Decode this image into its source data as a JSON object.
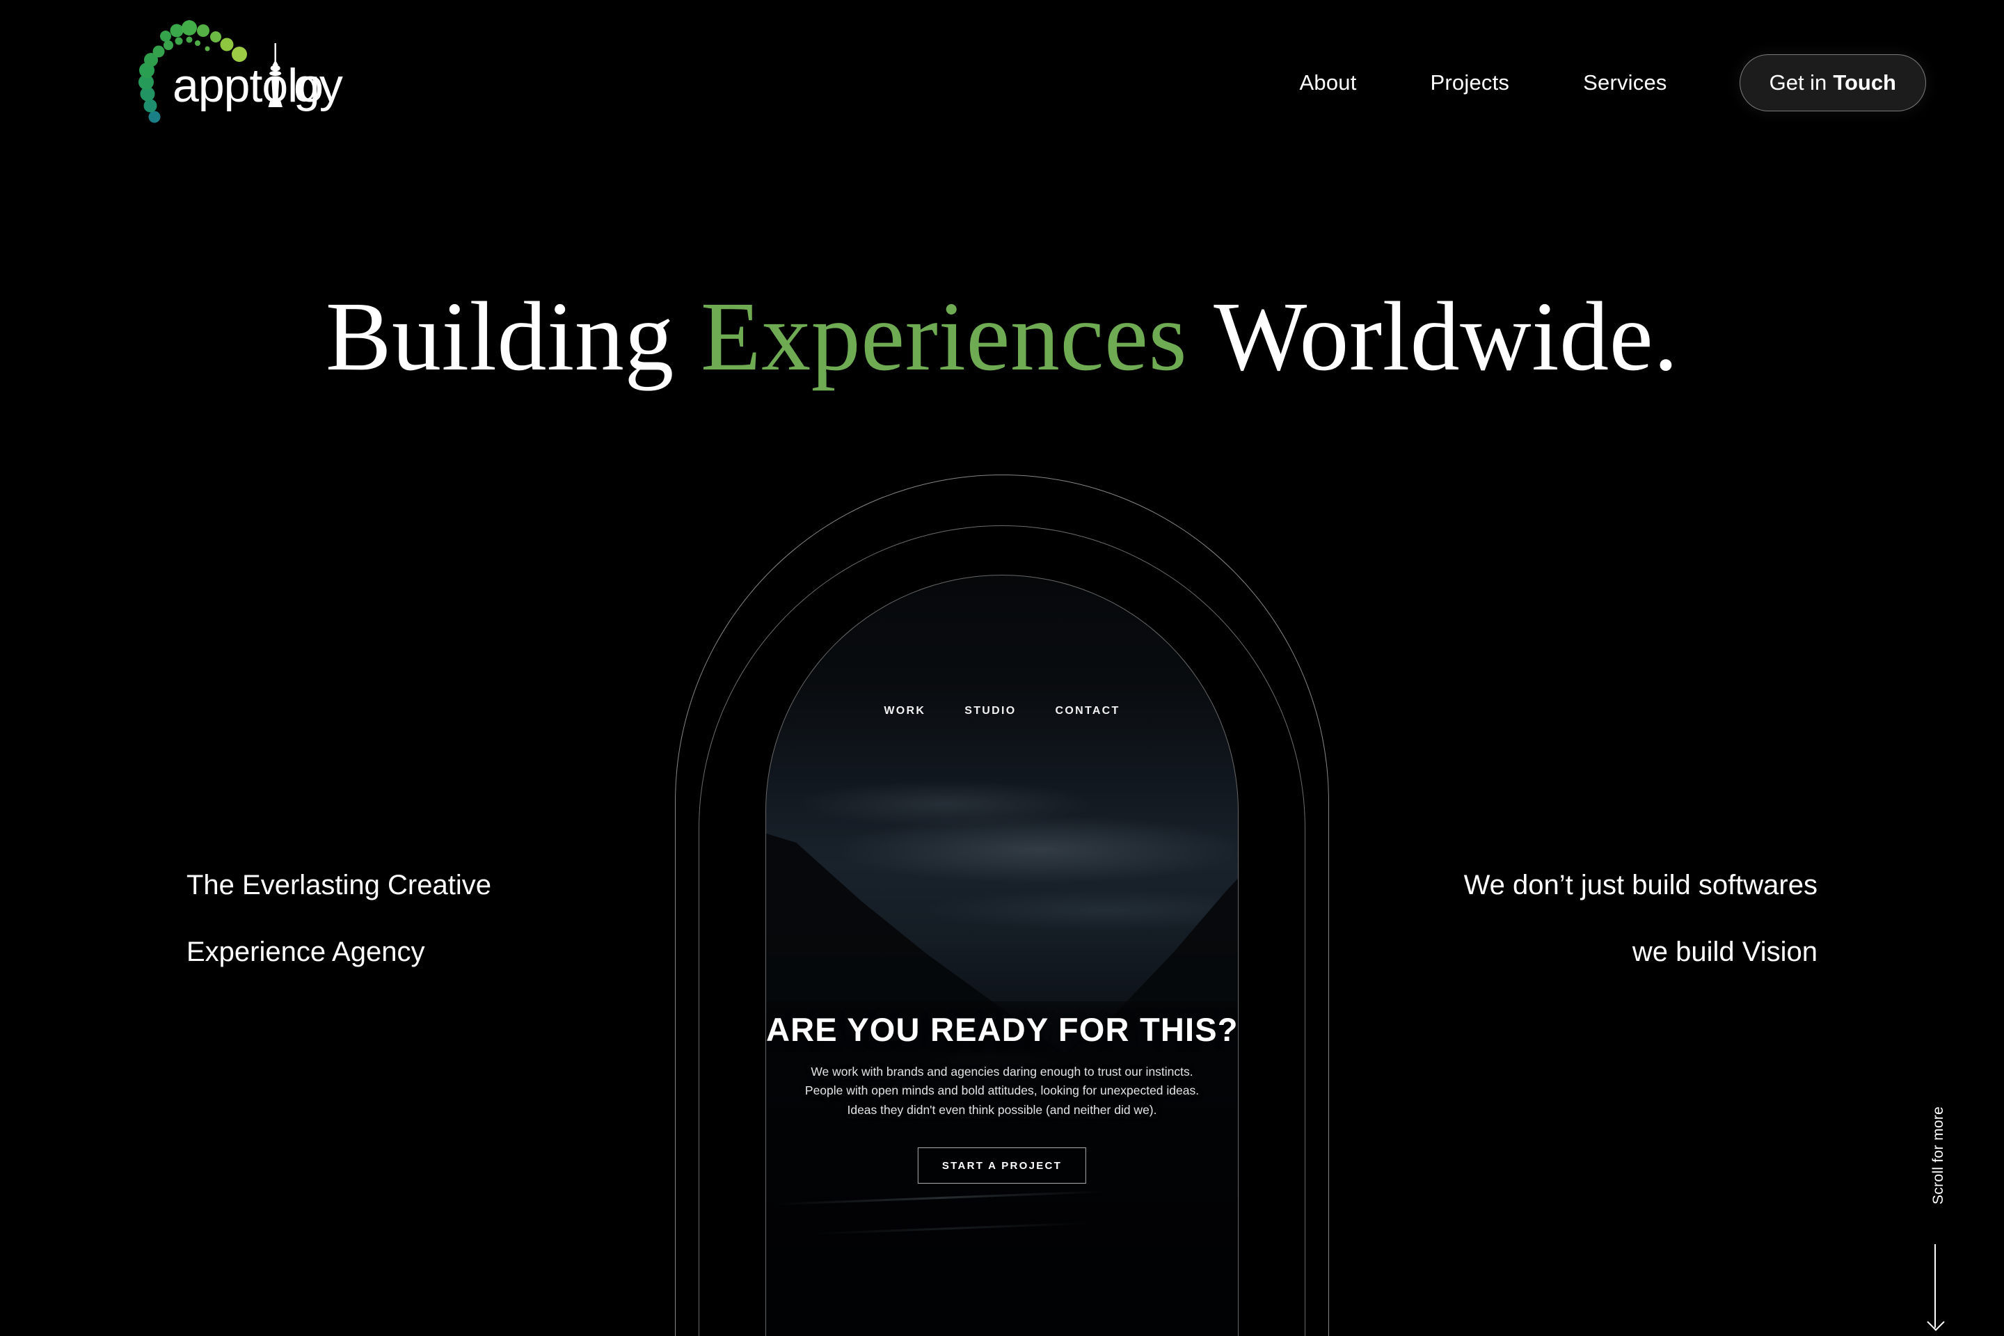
{
  "brand": {
    "name": "apptology",
    "logo_icon": "apptology-dot-arc-tower-logo",
    "dot_arc_colors": [
      "#2e9b60",
      "#2f9f4e",
      "#3fa94a",
      "#55b046",
      "#7cc04a",
      "#9ccb45",
      "#8ec63f",
      "#1e8e6e",
      "#1a7f86"
    ],
    "wordmark_color": "#ffffff"
  },
  "header": {
    "nav": [
      {
        "label": "About"
      },
      {
        "label": "Projects"
      },
      {
        "label": "Services"
      }
    ],
    "cta": {
      "label_regular": "Get in",
      "label_bold": "Touch",
      "background": "#1c1c1c",
      "border_color": "rgba(255,255,255,0.42)"
    }
  },
  "hero": {
    "headline_part1": "Building",
    "headline_accent": "Experiences",
    "headline_part2": "Worldwide.",
    "accent_color": "#6fab52",
    "text_color": "#ffffff"
  },
  "side_copy": {
    "left": {
      "line1": "The Everlasting Creative",
      "line2": "Experience Agency"
    },
    "right": {
      "line1": "We don’t just build softwares",
      "line2": "we build Vision"
    }
  },
  "arch_preview": {
    "mini_nav": [
      {
        "label": "WORK"
      },
      {
        "label": "STUDIO"
      },
      {
        "label": "CONTACT"
      }
    ],
    "headline": "ARE YOU READY FOR THIS?",
    "body_line1": "We work with brands and agencies daring enough to trust our instincts.",
    "body_line2": "People with open minds and bold attitudes, looking for unexpected ideas.",
    "body_line3": "Ideas they didn't even think possible (and neither did we).",
    "button_label": "START A PROJECT",
    "image_description": "dark misty mountain valley landscape"
  },
  "scroll_cue": {
    "label": "Scroll for more",
    "arrow_icon": "arrow-down-icon"
  },
  "theme": {
    "background": "#000000",
    "arch_stroke": "rgba(255,255,255,0.50)"
  }
}
